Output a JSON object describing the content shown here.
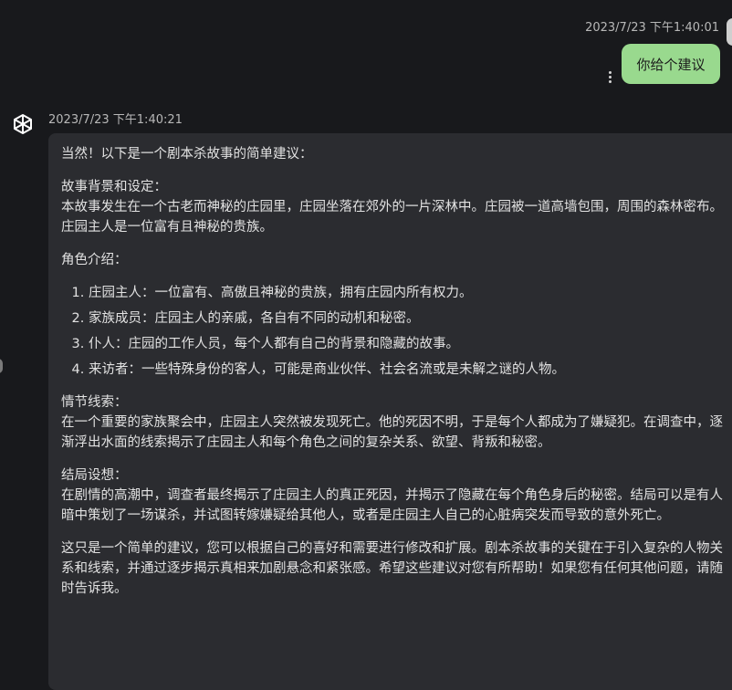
{
  "user_message": {
    "timestamp": "2023/7/23 下午1:40:01",
    "text": "你给个建议"
  },
  "assistant_message": {
    "timestamp": "2023/7/23 下午1:40:21",
    "intro": "当然！以下是一个剧本杀故事的简单建议：",
    "background_heading": "故事背景和设定：",
    "background_text": "本故事发生在一个古老而神秘的庄园里，庄园坐落在郊外的一片深林中。庄园被一道高墙包围，周围的森林密布。庄园主人是一位富有且神秘的贵族。",
    "roles_heading": "角色介绍：",
    "roles": [
      "庄园主人：一位富有、高傲且神秘的贵族，拥有庄园内所有权力。",
      "家族成员：庄园主人的亲戚，各自有不同的动机和秘密。",
      "仆人：庄园的工作人员，每个人都有自己的背景和隐藏的故事。",
      "来访者：一些特殊身份的客人，可能是商业伙伴、社会名流或是未解之谜的人物。"
    ],
    "clues_heading": "情节线索：",
    "clues_text": "在一个重要的家族聚会中，庄园主人突然被发现死亡。他的死因不明，于是每个人都成为了嫌疑犯。在调查中，逐渐浮出水面的线索揭示了庄园主人和每个角色之间的复杂关系、欲望、背叛和秘密。",
    "ending_heading": "结局设想：",
    "ending_text": "在剧情的高潮中，调查者最终揭示了庄园主人的真正死因，并揭示了隐藏在每个角色身后的秘密。结局可以是有人暗中策划了一场谋杀，并试图转嫁嫌疑给其他人，或者是庄园主人自己的心脏病突发而导致的意外死亡。",
    "closing_text": "这只是一个简单的建议，您可以根据自己的喜好和需要进行修改和扩展。剧本杀故事的关键在于引入复杂的人物关系和线索，并通过逐步揭示真相来加剧悬念和紧张感。希望这些建议对您有所帮助！如果您有任何其他问题，请随时告诉我。"
  },
  "icons": {
    "assistant_avatar": "openai-logo-icon",
    "more_options": "more-vertical-icon"
  },
  "colors": {
    "background": "#18191c",
    "user_bubble": "#99d98e",
    "assistant_bubble": "#2b2c30"
  }
}
